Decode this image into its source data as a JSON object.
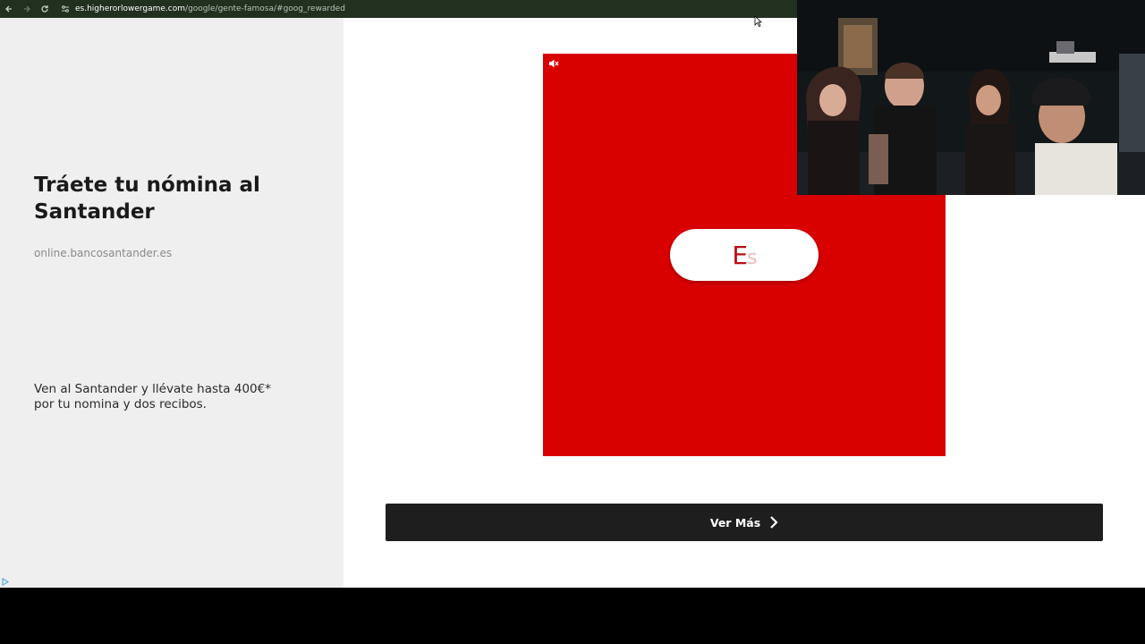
{
  "browser": {
    "back_icon": "arrow-left-icon",
    "forward_icon": "arrow-right-icon",
    "reload_icon": "reload-icon",
    "url_host": "es.higherorlowergame.com",
    "url_path": "/google/gente-famosa/#goog_rewarded"
  },
  "ad": {
    "title": "Tráete tu nómina al Santander",
    "domain": "online.bancosantander.es",
    "description": "Ven al Santander y llévate hasta 400€* por tu nomina y dos recibos.",
    "video_bg_color": "#d90000",
    "pill_text_main": "E",
    "pill_text_fade": "s",
    "cta_label": "Ver Más"
  },
  "colors": {
    "accent_red": "#d90000",
    "cta_bg": "#1e1e1e",
    "panel_bg": "#efefef"
  }
}
